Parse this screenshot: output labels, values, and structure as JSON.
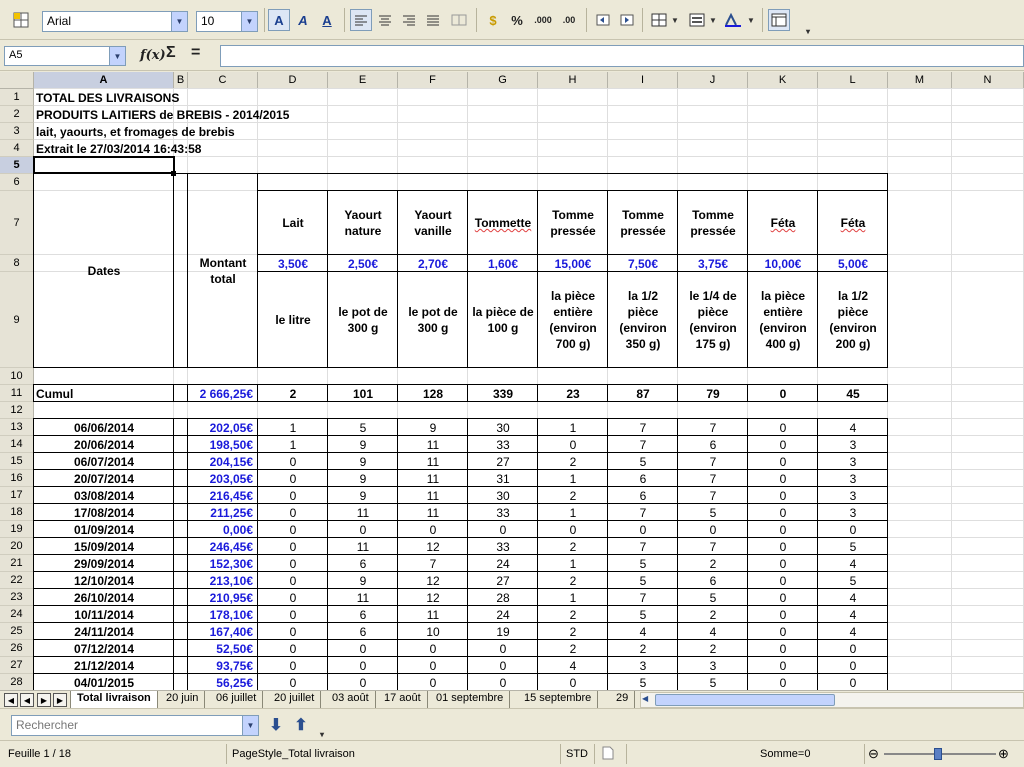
{
  "toolbar": {
    "font_name": "Arial",
    "font_size": "10",
    "percent_label": "%",
    "decimal_add_label": ".000",
    "decimal_del_label": ".00"
  },
  "formula_bar": {
    "cell_ref": "A5",
    "function_wizard_label": "f(x)",
    "sum_label": "Σ",
    "equals_label": "=",
    "formula": ""
  },
  "columns": [
    "A",
    "B",
    "C",
    "D",
    "E",
    "F",
    "G",
    "H",
    "I",
    "J",
    "K",
    "L",
    "M",
    "N"
  ],
  "rows": [
    "1",
    "2",
    "3",
    "4",
    "5",
    "6",
    "7",
    "8",
    "9",
    "10",
    "11",
    "12",
    "13",
    "14",
    "15",
    "16",
    "17",
    "18",
    "19",
    "20",
    "21",
    "22",
    "23",
    "24",
    "25",
    "26",
    "27",
    "28"
  ],
  "title": {
    "line1": "TOTAL DES LIVRAISONS",
    "line2": "PRODUITS LAITIERS de BREBIS - 2014/2015",
    "line3": "lait, yaourts, et fromages de brebis",
    "line4": "Extrait le 27/03/2014 16:43:58"
  },
  "header": {
    "dates": "Dates",
    "montant": "Montant total",
    "products": [
      {
        "name": "Lait",
        "price": "3,50€",
        "unit": "le litre"
      },
      {
        "name": "Yaourt nature",
        "price": "2,50€",
        "unit": "le pot de 300 g"
      },
      {
        "name": "Yaourt vanille",
        "price": "2,70€",
        "unit": "le pot de 300 g"
      },
      {
        "name": "Tommette",
        "price": "1,60€",
        "unit": "la pièce de 100 g"
      },
      {
        "name": "Tomme pressée",
        "price": "15,00€",
        "unit": "la pièce entière (environ 700 g)"
      },
      {
        "name": "Tomme pressée",
        "price": "7,50€",
        "unit": "la 1/2 pièce (environ 350 g)"
      },
      {
        "name": "Tomme pressée",
        "price": "3,75€",
        "unit": "le 1/4 de pièce (environ 175 g)"
      },
      {
        "name": "Féta",
        "price": "10,00€",
        "unit": "la pièce entière (environ 400 g)"
      },
      {
        "name": "Féta",
        "price": "5,00€",
        "unit": "la 1/2 pièce (environ 200 g)"
      }
    ]
  },
  "cumul": {
    "label": "Cumul",
    "total": "2 666,25€",
    "values": [
      "2",
      "101",
      "128",
      "339",
      "23",
      "87",
      "79",
      "0",
      "45"
    ]
  },
  "deliveries": [
    {
      "date": "06/06/2014",
      "total": "202,05€",
      "values": [
        "1",
        "5",
        "9",
        "30",
        "1",
        "7",
        "7",
        "0",
        "4"
      ]
    },
    {
      "date": "20/06/2014",
      "total": "198,50€",
      "values": [
        "1",
        "9",
        "11",
        "33",
        "0",
        "7",
        "6",
        "0",
        "3"
      ]
    },
    {
      "date": "06/07/2014",
      "total": "204,15€",
      "values": [
        "0",
        "9",
        "11",
        "27",
        "2",
        "5",
        "7",
        "0",
        "3"
      ]
    },
    {
      "date": "20/07/2014",
      "total": "203,05€",
      "values": [
        "0",
        "9",
        "11",
        "31",
        "1",
        "6",
        "7",
        "0",
        "3"
      ]
    },
    {
      "date": "03/08/2014",
      "total": "216,45€",
      "values": [
        "0",
        "9",
        "11",
        "30",
        "2",
        "6",
        "7",
        "0",
        "3"
      ]
    },
    {
      "date": "17/08/2014",
      "total": "211,25€",
      "values": [
        "0",
        "11",
        "11",
        "33",
        "1",
        "7",
        "5",
        "0",
        "3"
      ]
    },
    {
      "date": "01/09/2014",
      "total": "0,00€",
      "values": [
        "0",
        "0",
        "0",
        "0",
        "0",
        "0",
        "0",
        "0",
        "0"
      ]
    },
    {
      "date": "15/09/2014",
      "total": "246,45€",
      "values": [
        "0",
        "11",
        "12",
        "33",
        "2",
        "7",
        "7",
        "0",
        "5"
      ]
    },
    {
      "date": "29/09/2014",
      "total": "152,30€",
      "values": [
        "0",
        "6",
        "7",
        "24",
        "1",
        "5",
        "2",
        "0",
        "4"
      ]
    },
    {
      "date": "12/10/2014",
      "total": "213,10€",
      "values": [
        "0",
        "9",
        "12",
        "27",
        "2",
        "5",
        "6",
        "0",
        "5"
      ]
    },
    {
      "date": "26/10/2014",
      "total": "210,95€",
      "values": [
        "0",
        "11",
        "12",
        "28",
        "1",
        "7",
        "5",
        "0",
        "4"
      ]
    },
    {
      "date": "10/11/2014",
      "total": "178,10€",
      "values": [
        "0",
        "6",
        "11",
        "24",
        "2",
        "5",
        "2",
        "0",
        "4"
      ]
    },
    {
      "date": "24/11/2014",
      "total": "167,40€",
      "values": [
        "0",
        "6",
        "10",
        "19",
        "2",
        "4",
        "4",
        "0",
        "4"
      ]
    },
    {
      "date": "07/12/2014",
      "total": "52,50€",
      "values": [
        "0",
        "0",
        "0",
        "0",
        "2",
        "2",
        "2",
        "0",
        "0"
      ]
    },
    {
      "date": "21/12/2014",
      "total": "93,75€",
      "values": [
        "0",
        "0",
        "0",
        "0",
        "4",
        "3",
        "3",
        "0",
        "0"
      ]
    },
    {
      "date": "04/01/2015",
      "total": "56,25€",
      "values": [
        "0",
        "0",
        "0",
        "0",
        "0",
        "5",
        "5",
        "0",
        "0"
      ]
    }
  ],
  "sheet_tabs": [
    "Total livraison",
    "20 juin",
    "06 juillet",
    "20 juillet",
    "03 août",
    "17 août",
    "01 septembre",
    "15 septembre",
    "29"
  ],
  "active_tab": "Total livraison",
  "find_toolbar": {
    "placeholder": "Rechercher"
  },
  "status_bar": {
    "sheet_info": "Feuille 1 / 18",
    "page_style": "PageStyle_Total livraison",
    "mode": "STD",
    "sum": "Somme=0"
  },
  "colors": {
    "accent_blue": "#1a1adb",
    "ui_background": "#ece9d8"
  }
}
